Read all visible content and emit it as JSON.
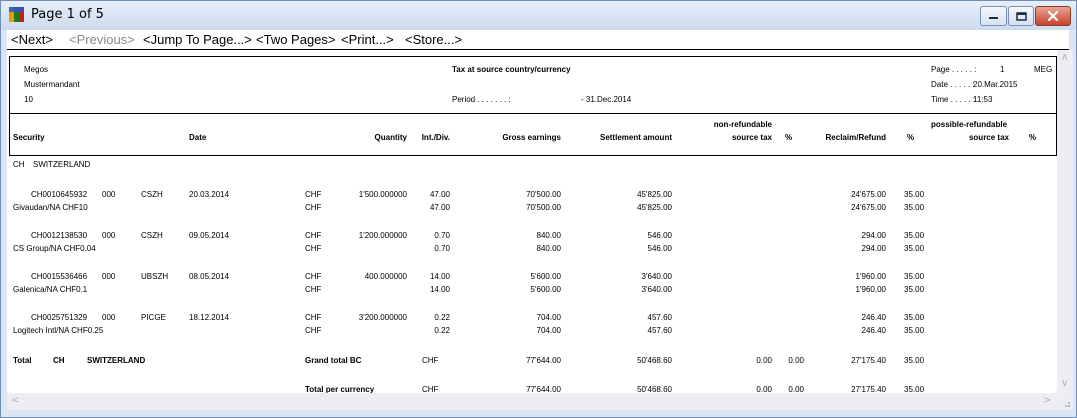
{
  "window": {
    "title": "Page 1 of 5"
  },
  "toolbar": {
    "next": "<Next>",
    "previous": "<Previous>",
    "jump": "<Jump To Page...>",
    "two_pages": "<Two Pages>",
    "print": "<Print...>",
    "store": "<Store...>"
  },
  "report": {
    "company": "Megos",
    "client": "Mustermandant",
    "client_no": "10",
    "title": "Tax at source country/currency",
    "period_label": "Period . . . . . . . :",
    "period_value": "- 31.Dec.2014",
    "page_label": "Page . . . . . :",
    "page_value": "1",
    "page_code": "MEG",
    "date_label": "Date . . . . . :",
    "date_value": "20.Mar.2015",
    "time_label": "Time . . . . . :",
    "time_value": "11:53"
  },
  "columns": {
    "security": "Security",
    "date": "Date",
    "quantity": "Quantity",
    "int_div": "Int./Div.",
    "gross": "Gross earnings",
    "settlement": "Settlement amount",
    "nonref_1": "non-refundable",
    "nonref_2": "source tax",
    "pct1": "%",
    "reclaim": "Reclaim/Refund",
    "pct2": "%",
    "possref_1": "possible-refundable",
    "possref_2": "source tax",
    "pct3": "%"
  },
  "country": {
    "code": "CH",
    "name": "SWITZERLAND"
  },
  "positions": [
    {
      "isin": "CH0010645932",
      "sub": "000",
      "bank": "CSZH",
      "date": "20.03.2014",
      "name": "Givaudan/NA CHF10",
      "currency": "CHF",
      "quantity": "1'500.000000",
      "int_div": "47.00",
      "gross": "70'500.00",
      "settlement": "45'825.00",
      "reclaim": "24'675.00",
      "pct": "35.00"
    },
    {
      "isin": "CH0012138530",
      "sub": "000",
      "bank": "CSZH",
      "date": "09.05.2014",
      "name": "CS Group/NA CHF0.04",
      "currency": "CHF",
      "quantity": "1'200.000000",
      "int_div": "0.70",
      "gross": "840.00",
      "settlement": "546.00",
      "reclaim": "294.00",
      "pct": "35.00"
    },
    {
      "isin": "CH0015536466",
      "sub": "000",
      "bank": "UBSZH",
      "date": "08.05.2014",
      "name": "Galenica/NA CHF0.1",
      "currency": "CHF",
      "quantity": "400.000000",
      "int_div": "14.00",
      "gross": "5'600.00",
      "settlement": "3'640.00",
      "reclaim": "1'960.00",
      "pct": "35.00"
    },
    {
      "isin": "CH0025751329",
      "sub": "000",
      "bank": "PICGE",
      "date": "18.12.2014",
      "name": "Logitech Intl/NA CHF0.25",
      "currency": "CHF",
      "quantity": "3'200.000000",
      "int_div": "0.22",
      "gross": "704.00",
      "settlement": "457.60",
      "reclaim": "246.40",
      "pct": "35.00"
    }
  ],
  "totals": {
    "label": "Total",
    "code": "CH",
    "name": "SWITZERLAND",
    "grand_label": "Grand total BC",
    "grand_currency": "CHF",
    "grand_gross": "77'644.00",
    "grand_settlement": "50'468.60",
    "grand_nonref": "0.00",
    "grand_pct": "0.00",
    "grand_reclaim": "27'175.40",
    "grand_reclaim_pct": "35.00",
    "per_label": "Total per currency",
    "per_currency": "CHF",
    "per_gross": "77'644.00",
    "per_settlement": "50'468.60",
    "per_nonref": "0.00",
    "per_pct": "0.00",
    "per_reclaim": "27'175.40",
    "per_reclaim_pct": "35.00"
  }
}
